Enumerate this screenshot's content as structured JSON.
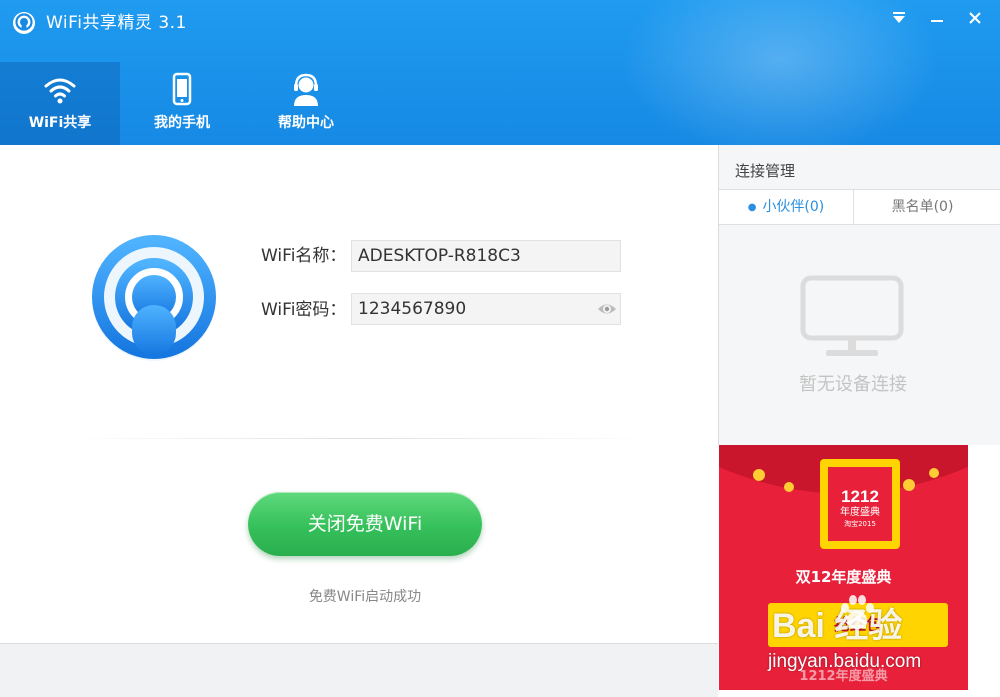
{
  "window": {
    "title": "WiFi共享精灵 3.1",
    "controls": {
      "dropdown": "▾",
      "minimize": "–",
      "close": "✕"
    }
  },
  "nav": {
    "items": [
      {
        "label": "WiFi共享",
        "icon": "wifi-icon",
        "active": true
      },
      {
        "label": "我的手机",
        "icon": "phone-icon",
        "active": false
      },
      {
        "label": "帮助中心",
        "icon": "support-agent-icon",
        "active": false
      }
    ]
  },
  "share": {
    "name_label": "WiFi名称：",
    "name_value": "ADESKTOP-R818C3",
    "password_label": "WiFi密码：",
    "password_value": "1234567890",
    "action_button": "关闭免费WiFi",
    "status": "免费WiFi启动成功"
  },
  "connections": {
    "title": "连接管理",
    "tabs": [
      {
        "label": "小伙伴(0)",
        "active": true
      },
      {
        "label": "黑名单(0)",
        "active": false
      }
    ],
    "empty_text": "暂无设备连接"
  },
  "ad": {
    "badge_number": "1212",
    "badge_subtitle": "年度盛典",
    "badge_small": "淘宝2015",
    "title": "双12年度盛典",
    "button": "抢红包",
    "bottom_text": "1212年度盛典"
  },
  "watermark": {
    "logo": "Bai 经验",
    "url": "jingyan.baidu.com"
  },
  "colors": {
    "header_blue": "#1689e4",
    "accent_blue": "#2a8fe0",
    "button_green": "#35c05a",
    "ad_red": "#e8203a",
    "ad_yellow": "#ffd400"
  }
}
